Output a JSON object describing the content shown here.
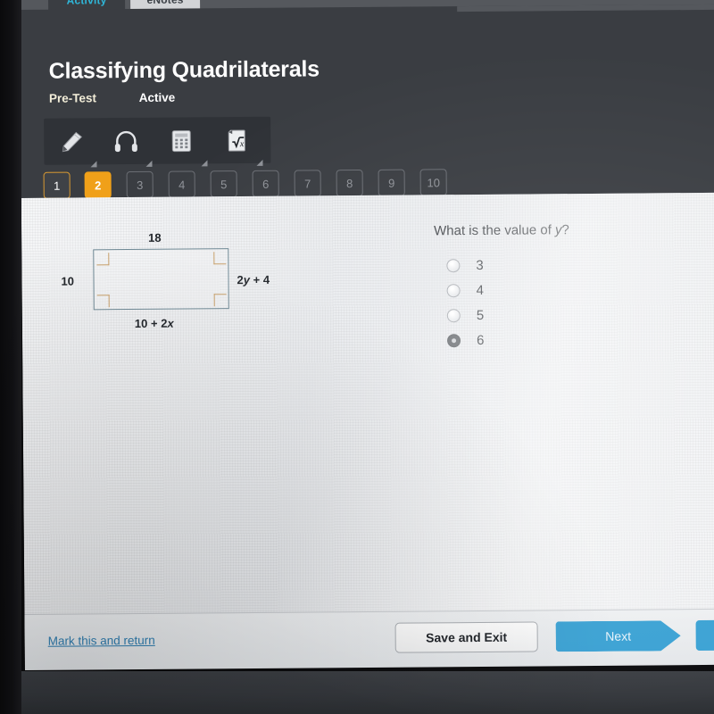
{
  "tabs": [
    {
      "label": "Activity",
      "state": "active"
    },
    {
      "label": "eNotes",
      "state": "inactive"
    }
  ],
  "header": {
    "title": "Classifying Quadrilaterals",
    "test_type": "Pre-Test",
    "status": "Active"
  },
  "toolbar": {
    "tools": [
      {
        "name": "pencil-icon",
        "label": "Highlighter"
      },
      {
        "name": "headphones-icon",
        "label": "Read Aloud"
      },
      {
        "name": "calculator-icon",
        "label": "Calculator"
      },
      {
        "name": "formula-icon",
        "label": "Formula Sheet"
      }
    ]
  },
  "question_nav": {
    "items": [
      {
        "number": "1",
        "state": "visited"
      },
      {
        "number": "2",
        "state": "current"
      },
      {
        "number": "3",
        "state": "locked"
      },
      {
        "number": "4",
        "state": "locked"
      },
      {
        "number": "5",
        "state": "locked"
      },
      {
        "number": "6",
        "state": "locked"
      },
      {
        "number": "7",
        "state": "locked"
      },
      {
        "number": "8",
        "state": "locked"
      },
      {
        "number": "9",
        "state": "locked"
      },
      {
        "number": "10",
        "state": "locked"
      }
    ]
  },
  "figure": {
    "shape": "rectangle",
    "top_label": "18",
    "left_label": "10",
    "right_label_prefix": "2",
    "right_label_var": "y",
    "right_label_suffix": " + 4",
    "bottom_label_prefix": "10 + 2",
    "bottom_label_var": "x",
    "outline_color": "#6e8894",
    "right_angle_color": "#c8a06a"
  },
  "question": {
    "prompt_prefix": "What is the value of ",
    "prompt_var": "y",
    "prompt_suffix": "?",
    "choices": [
      {
        "label": "3",
        "selected": false
      },
      {
        "label": "4",
        "selected": false
      },
      {
        "label": "5",
        "selected": false
      },
      {
        "label": "6",
        "selected": true
      }
    ]
  },
  "footer": {
    "mark_link": "Mark this and return",
    "save_label": "Save and Exit",
    "next_label": "Next",
    "submit_label": ""
  },
  "colors": {
    "accent_orange": "#f0a019",
    "accent_blue": "#3ba2d4",
    "link_blue": "#2f7fb3",
    "header_dark": "#3a3d42"
  }
}
